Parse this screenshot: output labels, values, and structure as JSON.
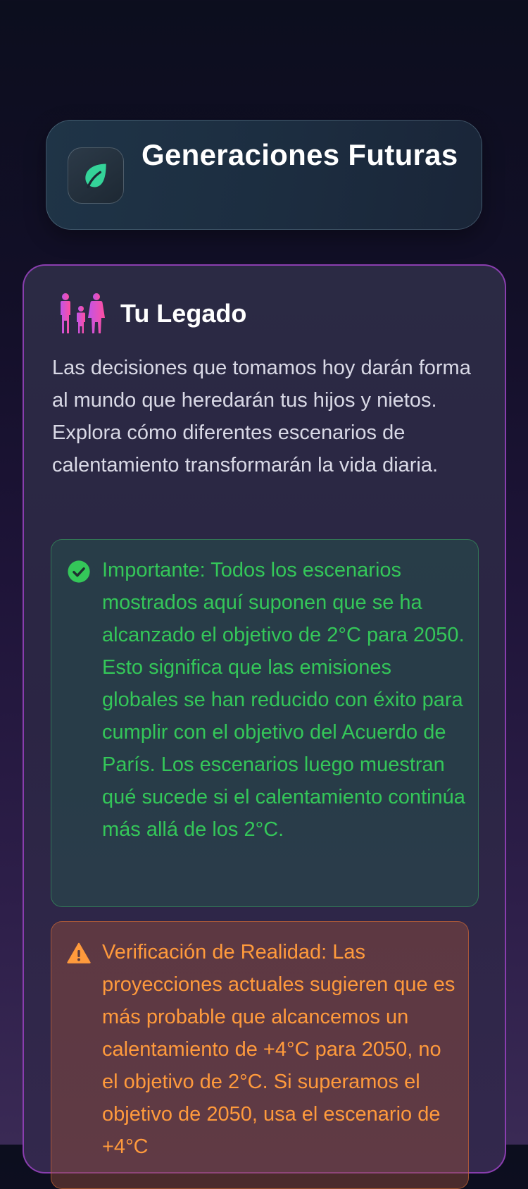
{
  "header": {
    "title": "Generaciones Futuras",
    "icon": "leaf-icon",
    "icon_color": "#34d399"
  },
  "legacy_card": {
    "icon": "family-icon",
    "title": "Tu Legado",
    "description": "Las decisiones que tomamos hoy darán forma al mundo que heredarán tus hijos y nietos. Explora cómo diferentes escenarios de calentamiento transformarán la vida diaria.",
    "success_note": {
      "icon": "check-circle-icon",
      "color": "#34c759",
      "text": "Importante: Todos los escenarios mostrados aquí suponen que se ha alcanzado el objetivo de 2°C para 2050. Esto significa que las emisiones globales se han reducido con éxito para cumplir con el objetivo del Acuerdo de París. Los escenarios luego muestran qué sucede si el calentamiento continúa más allá de los 2°C."
    },
    "warning_note": {
      "icon": "warning-triangle-icon",
      "color": "#ff9a3c",
      "text": "Verificación de Realidad: Las proyecciones actuales sugieren que es más probable que alcancemos un calentamiento de +4°C para 2050, no el objetivo de 2°C. Si superamos el objetivo de 2050, usa el escenario de +4°C"
    }
  }
}
